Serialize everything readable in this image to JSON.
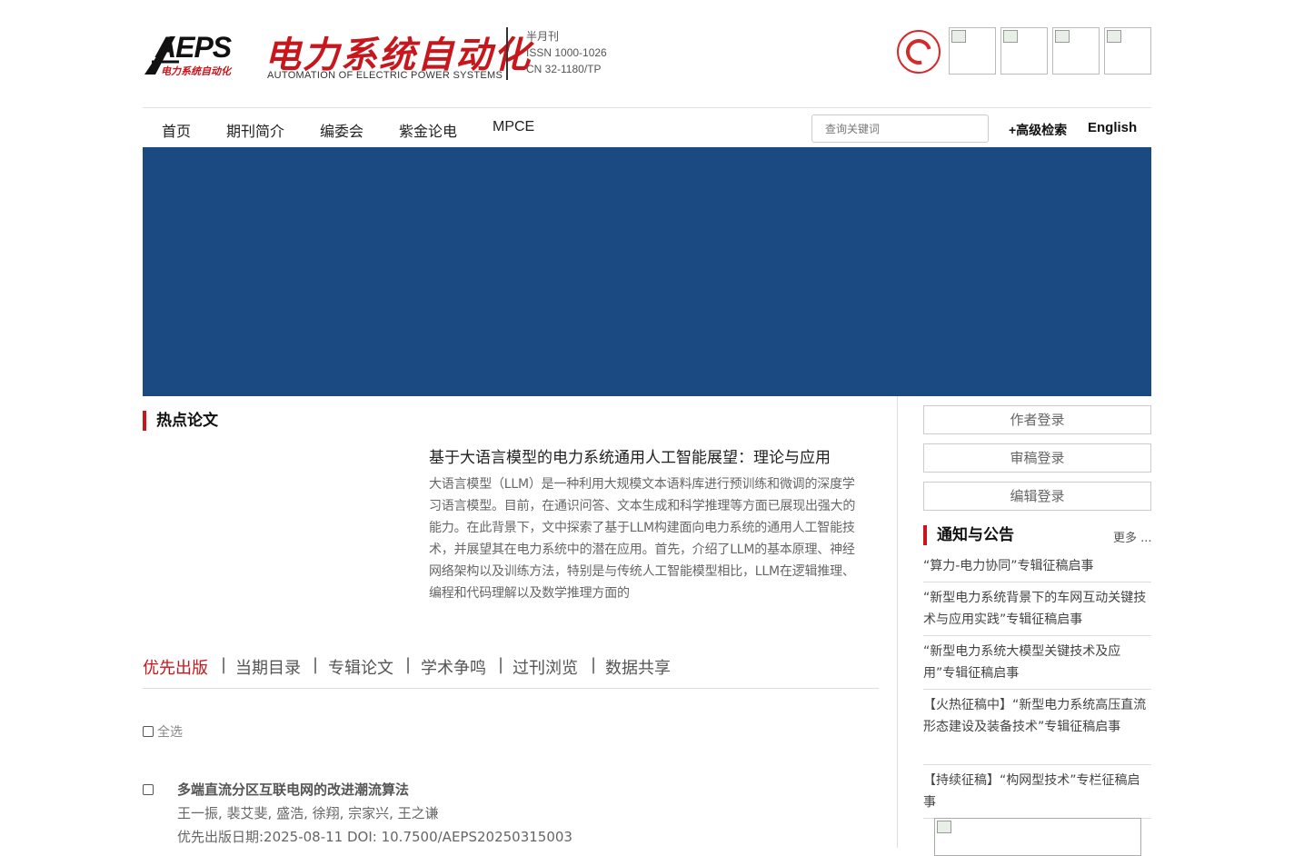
{
  "header": {
    "logo_abbr": "AEPS",
    "logo_sub": "电力系统自动化",
    "title_cn": "电力系统自动化",
    "title_en": "AUTOMATION OF ELECTRIC POWER SYSTEMS",
    "frequency": "半月刊",
    "issn": "ISSN 1000-1026",
    "cn": "CN 32-1180/TP"
  },
  "nav": {
    "items": [
      "首页",
      "期刊简介",
      "编委会",
      "紫金论电",
      "MPCE"
    ],
    "search_placeholder": "查询关键词",
    "advanced_search": "+高级检索",
    "english": "English"
  },
  "hot": {
    "section_title": "热点论文",
    "paper_title": "基于大语言模型的电力系统通用人工智能展望：理论与应用",
    "abstract": "大语言模型（LLM）是一种利用大规模文本语料库进行预训练和微调的深度学习语言模型。目前，在通识问答、文本生成和科学推理等方面已展现出强大的能力。在此背景下，文中探索了基于LLM构建面向电力系统的通用人工智能技术，并展望其在电力系统中的潜在应用。首先，介绍了LLM的基本原理、神经网络架构以及训练方法，特别是与传统人工智能模型相比，LLM在逻辑推理、编程和代码理解以及数学推理方面的"
  },
  "tabs": {
    "items": [
      "优先出版",
      "当期目录",
      "专辑论文",
      "学术争鸣",
      "过刊浏览",
      "数据共享"
    ],
    "separator": "|",
    "active_index": 0
  },
  "list": {
    "select_all": "全选",
    "article": {
      "title": "多端直流分区互联电网的改进潮流算法",
      "authors": "王一振, 裴艾斐, 盛浩, 徐翔, 宗家兴, 王之谦",
      "meta": "优先出版日期:2025-08-11   DOI: 10.7500/AEPS20250315003"
    }
  },
  "sidebar": {
    "logins": [
      "作者登录",
      "审稿登录",
      "编辑登录"
    ],
    "notice_title": "通知与公告",
    "more": "更多 ...",
    "notices": [
      "“算力-电力协同”专辑征稿启事",
      "“新型电力系统背景下的车网互动关键技术与应用实践”专辑征稿启事",
      "“新型电力系统大模型关键技术及应用”专辑征稿启事",
      "【火热征稿中】“新型电力系统高压直流形态建设及装备技术”专辑征稿启事",
      "【持续征稿】“构网型技术”专栏征稿启事"
    ]
  },
  "colors": {
    "brand_red": "#c8161d",
    "banner_blue": "#1b4981"
  }
}
